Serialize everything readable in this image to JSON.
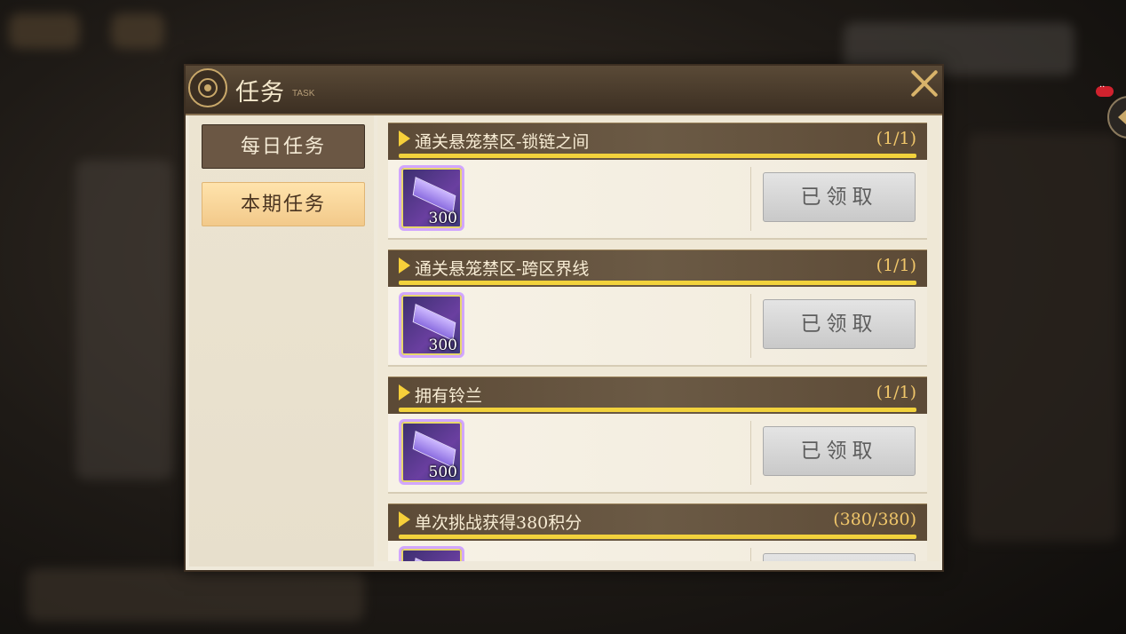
{
  "dialog": {
    "title": "任务",
    "subtitle": "TASK"
  },
  "tabs": [
    {
      "label": "每日任务",
      "selected": false
    },
    {
      "label": "本期任务",
      "selected": true
    }
  ],
  "tasks": [
    {
      "name": "通关悬笼禁区-锁链之间",
      "progress": "(1/1)",
      "reward_count": "300",
      "button": "已领取"
    },
    {
      "name": "通关悬笼禁区-跨区界线",
      "progress": "(1/1)",
      "reward_count": "300",
      "button": "已领取"
    },
    {
      "name": "拥有铃兰",
      "progress": "(1/1)",
      "reward_count": "500",
      "button": "已领取"
    },
    {
      "name": "单次挑战获得380积分",
      "progress": "(380/380)",
      "reward_count": "",
      "button": ""
    }
  ],
  "colors": {
    "accent_gold": "#f6cf3a",
    "header_brown": "#5c4a36",
    "selected_tab": "#f2c98a",
    "claimed_button": "#d4d4d4"
  }
}
